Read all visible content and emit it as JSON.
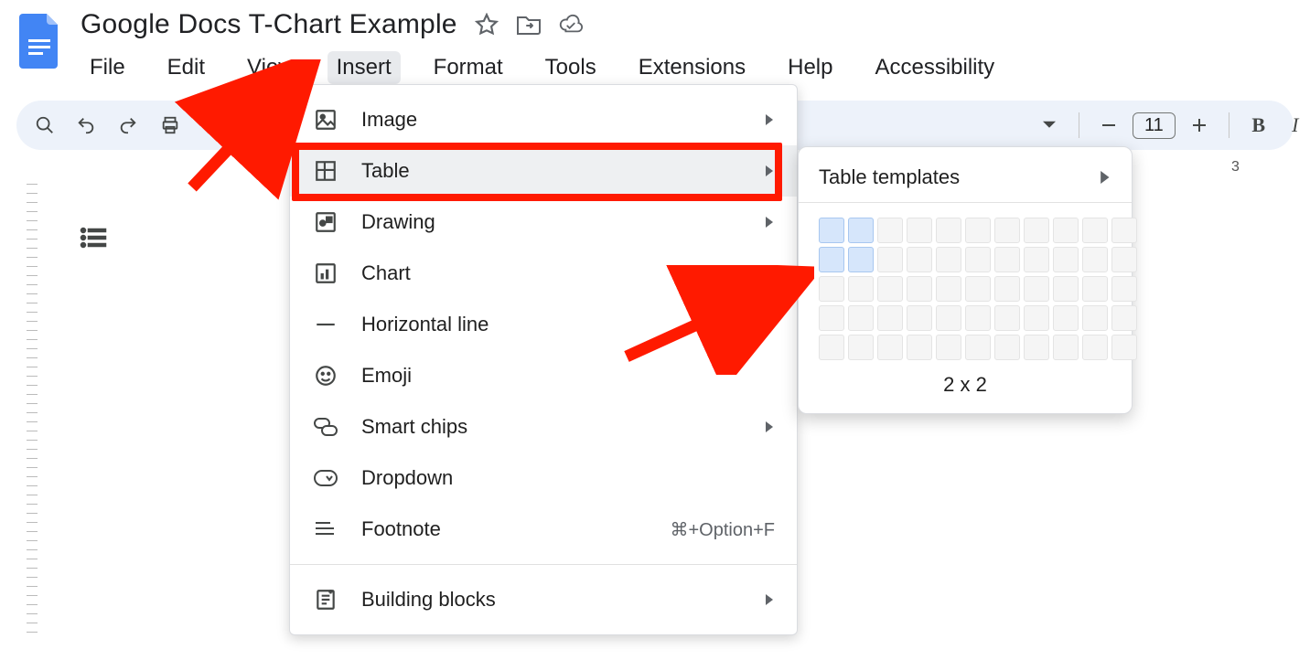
{
  "doc": {
    "title": "Google Docs T-Chart Example"
  },
  "menubar": [
    "File",
    "Edit",
    "View",
    "Insert",
    "Format",
    "Tools",
    "Extensions",
    "Help",
    "Accessibility"
  ],
  "menubar_active_index": 3,
  "toolbar": {
    "font_size": "11"
  },
  "ruler": {
    "mark1": "3"
  },
  "insert_menu": {
    "items": [
      {
        "label": "Image",
        "icon": "image-icon",
        "arrow": true
      },
      {
        "label": "Table",
        "icon": "table-icon",
        "arrow": true,
        "highlight": true
      },
      {
        "label": "Drawing",
        "icon": "drawing-icon",
        "arrow": true
      },
      {
        "label": "Chart",
        "icon": "chart-icon",
        "arrow": true
      },
      {
        "label": "Horizontal line",
        "icon": "hline-icon"
      },
      {
        "label": "Emoji",
        "icon": "emoji-icon"
      },
      {
        "label": "Smart chips",
        "icon": "chips-icon",
        "arrow": true
      },
      {
        "label": "Dropdown",
        "icon": "dropdown-icon"
      },
      {
        "label": "Footnote",
        "icon": "footnote-icon",
        "shortcut": "⌘+Option+F"
      },
      {
        "label": "Building blocks",
        "icon": "blocks-icon",
        "arrow": true,
        "separator_before": true
      }
    ]
  },
  "table_submenu": {
    "templates_label": "Table templates",
    "grid_cols": 11,
    "grid_rows": 5,
    "selected_cols": 2,
    "selected_rows": 2,
    "caption": "2 x 2"
  }
}
